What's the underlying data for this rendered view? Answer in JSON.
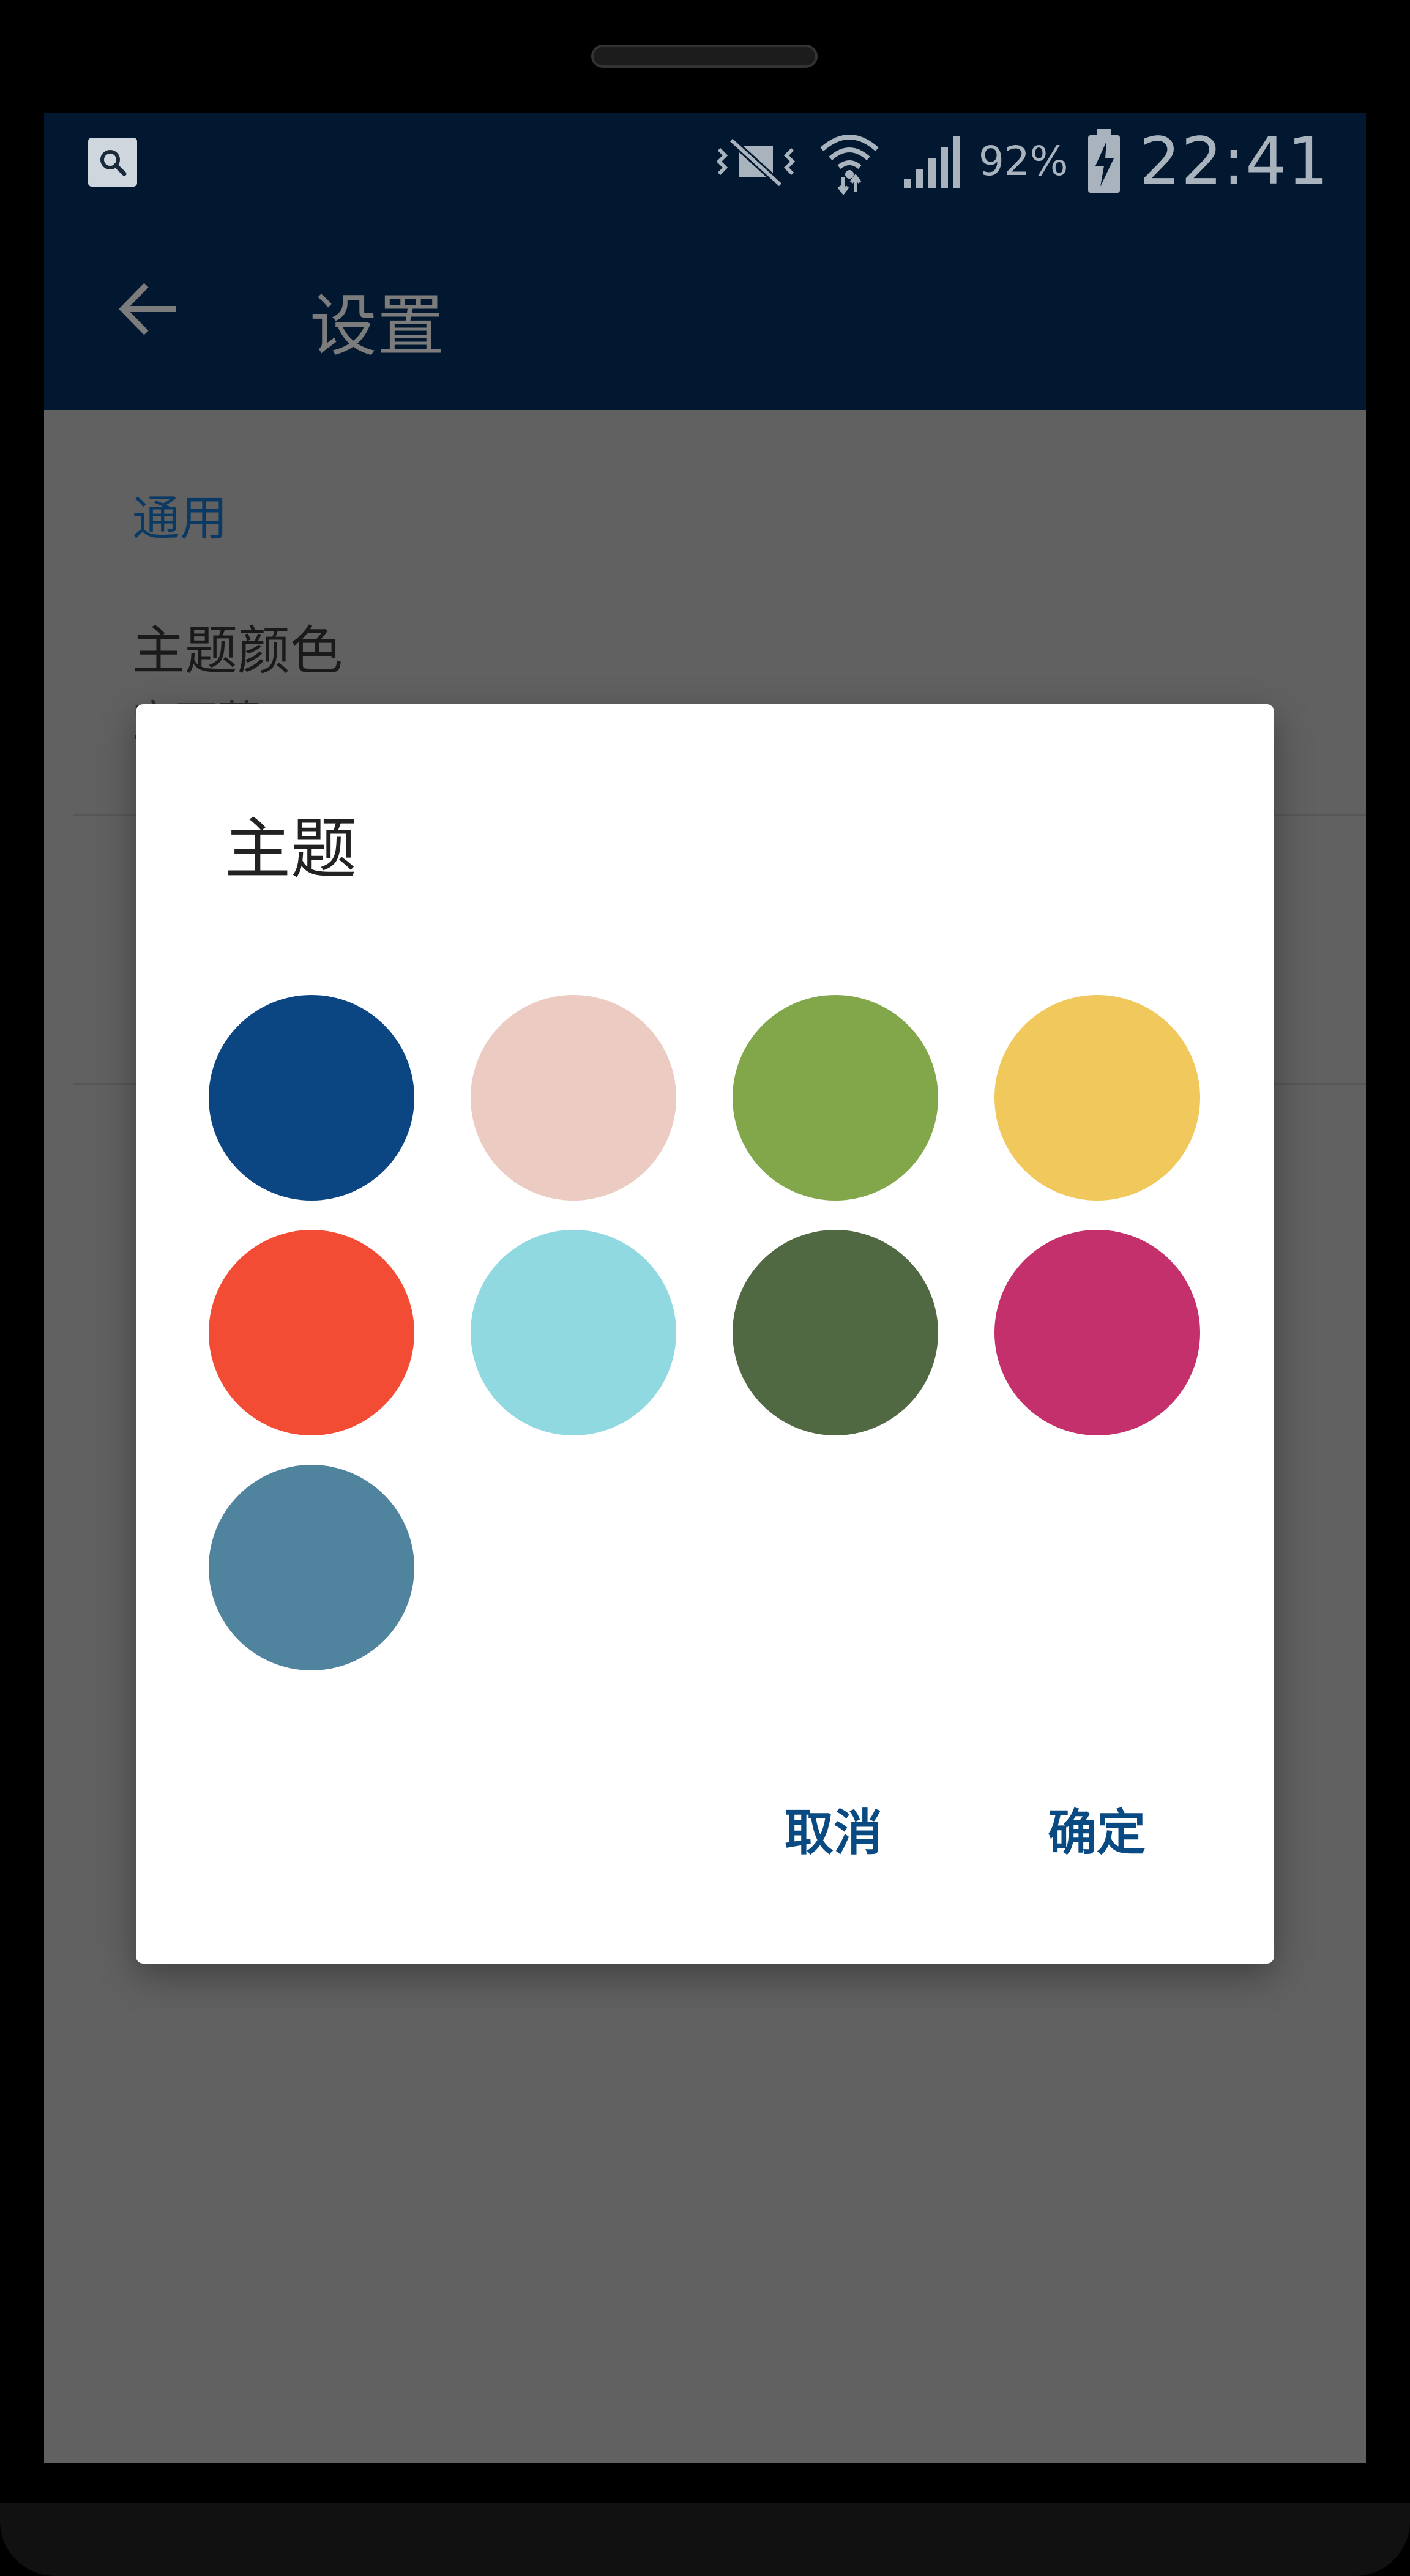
{
  "status_bar": {
    "left_icon": "search-notification-icon",
    "icons": [
      "vibrate-icon",
      "wifi-icon",
      "signal-icon",
      "battery-charging-icon"
    ],
    "battery_percent": "92%",
    "time": "22:41"
  },
  "app_bar": {
    "back_icon": "arrow-left-icon",
    "title": "设置"
  },
  "settings": {
    "section_header": "通用",
    "theme_pref": {
      "title": "主题颜色",
      "summary": "宝石蓝"
    }
  },
  "dialog": {
    "title": "主题",
    "swatches": [
      {
        "color": "#0B4582"
      },
      {
        "color": "#EBCBC2"
      },
      {
        "color": "#82A74A"
      },
      {
        "color": "#F0C85C"
      },
      {
        "color": "#F24C35"
      },
      {
        "color": "#91D9E0"
      },
      {
        "color": "#516943"
      },
      {
        "color": "#C4306B"
      },
      {
        "color": "#50839D"
      }
    ],
    "cancel_label": "取消",
    "confirm_label": "确定"
  },
  "colors": {
    "app_bar_bg": "#011830",
    "accent": "#0A4A82",
    "scrim_bg": "#616161"
  }
}
